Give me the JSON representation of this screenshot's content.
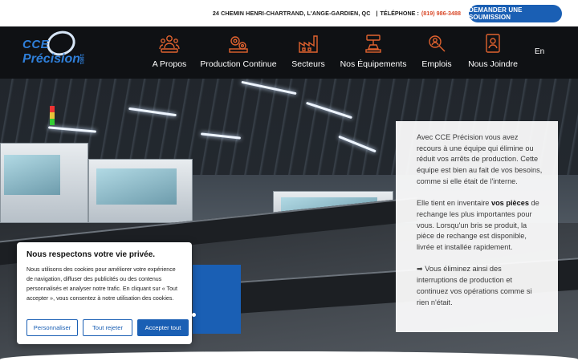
{
  "topbar": {
    "address": "24 CHEMIN HENRI-CHARTRAND, L'ANGE-GARDIEN, QC",
    "separator": "|",
    "phone_label": "TÉLÉPHONE :",
    "phone": "(819) 986-3488",
    "cta_label": "DEMANDER UNE SOUMISSION"
  },
  "logo": {
    "line1": "CCE",
    "line2": "Précision",
    "year": "1981"
  },
  "nav": {
    "items": [
      {
        "label": "A Propos",
        "icon": "team-icon"
      },
      {
        "label": "Production Continue",
        "icon": "gears-icon"
      },
      {
        "label": "Secteurs",
        "icon": "factory-icon"
      },
      {
        "label": "Nos Équipements",
        "icon": "robot-arm-icon"
      },
      {
        "label": "Emplois",
        "icon": "job-search-icon"
      },
      {
        "label": "Nous Joindre",
        "icon": "contact-book-icon"
      }
    ],
    "language": "En"
  },
  "card": {
    "p1": "Avec CCE Précision vous avez recours à une équipe qui élimine ou réduit vos arrêts de production. Cette équipe est bien au fait de vos besoins, comme si elle était de l'interne.",
    "p2_before": "Elle tient en inventaire ",
    "p2_bold": "vos pièces",
    "p2_after": " de rechange les plus importantes pour vous. Lorsqu'un bris se produit, la pièce de rechange est disponible, livrée et installée rapidement.",
    "p3": "➡ Vous éliminez ainsi des interruptions de production et continuez vos opérations comme si rien n'était."
  },
  "cookie": {
    "title": "Nous respectons votre vie privée.",
    "text": "Nous utilisons des cookies pour améliorer votre expérience de navigation, diffuser des publicités ou des contenus personnalisés et analyser notre trafic. En cliquant sur « Tout accepter », vous consentez à notre utilisation des cookies.",
    "customize": "Personnaliser",
    "reject": "Tout rejeter",
    "accept": "Accepter tout"
  },
  "colors": {
    "accent": "#1a5fb4",
    "phone": "#d94a2a",
    "icon_orange": "#e0622f",
    "nav_bg": "#0f1114"
  }
}
